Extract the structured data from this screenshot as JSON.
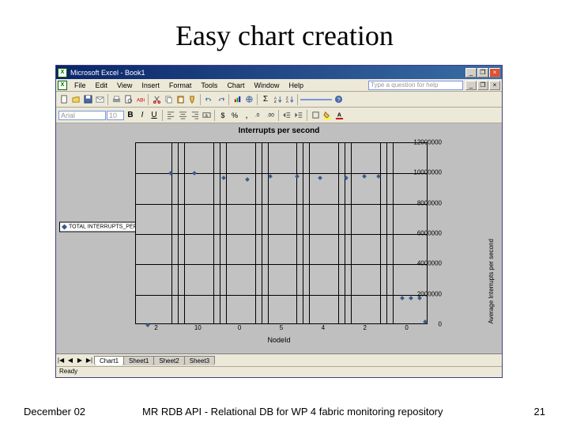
{
  "slide": {
    "title": "Easy chart creation",
    "footer_date": "December 02",
    "footer_center": "MR RDB API - Relational DB for WP 4 fabric monitoring repository",
    "footer_page": "21"
  },
  "excel": {
    "window_title": "Microsoft Excel - Book1",
    "help_placeholder": "Type a question for help",
    "menu": {
      "file": "File",
      "edit": "Edit",
      "view": "View",
      "insert": "Insert",
      "format": "Format",
      "tools": "Tools",
      "chart": "Chart",
      "window": "Window",
      "help": "Help"
    },
    "toolbar2_font": "Arial",
    "toolbar2_size": "10",
    "status": "Ready",
    "sheets": {
      "nav": [
        "|◀",
        "◀",
        "▶",
        "▶|"
      ],
      "tab1": "Chart1",
      "tab2": "Sheet1",
      "tab3": "Sheet2",
      "tab4": "Sheet3"
    }
  },
  "chart_data": {
    "type": "scatter",
    "title": "Interrupts per second",
    "xlabel": "NodeId",
    "ylabel": "Average Interrupts per second",
    "legend": "TOTAL INTERRUPTS_PER_SECOND",
    "x_ticks": [
      "2",
      "10",
      "0",
      "5",
      "4",
      "2",
      "0"
    ],
    "y_ticks": [
      "0",
      "2000000",
      "4000000",
      "6000000",
      "8000000",
      "10000000",
      "12000000"
    ],
    "ylim": [
      0,
      12000000
    ],
    "series": [
      {
        "name": "TOTAL INTERRUPTS_PER_SECOND",
        "points": [
          {
            "x_frac": 0.04,
            "y": 0
          },
          {
            "x_frac": 0.12,
            "y": 10000000
          },
          {
            "x_frac": 0.2,
            "y": 10000000
          },
          {
            "x_frac": 0.3,
            "y": 9700000
          },
          {
            "x_frac": 0.38,
            "y": 9600000
          },
          {
            "x_frac": 0.46,
            "y": 9800000
          },
          {
            "x_frac": 0.55,
            "y": 9800000
          },
          {
            "x_frac": 0.63,
            "y": 9700000
          },
          {
            "x_frac": 0.72,
            "y": 9700000
          },
          {
            "x_frac": 0.78,
            "y": 9800000
          },
          {
            "x_frac": 0.83,
            "y": 9800000
          },
          {
            "x_frac": 0.91,
            "y": 1800000
          },
          {
            "x_frac": 0.94,
            "y": 1800000
          },
          {
            "x_frac": 0.97,
            "y": 1800000
          },
          {
            "x_frac": 0.99,
            "y": 200000
          }
        ]
      }
    ]
  }
}
